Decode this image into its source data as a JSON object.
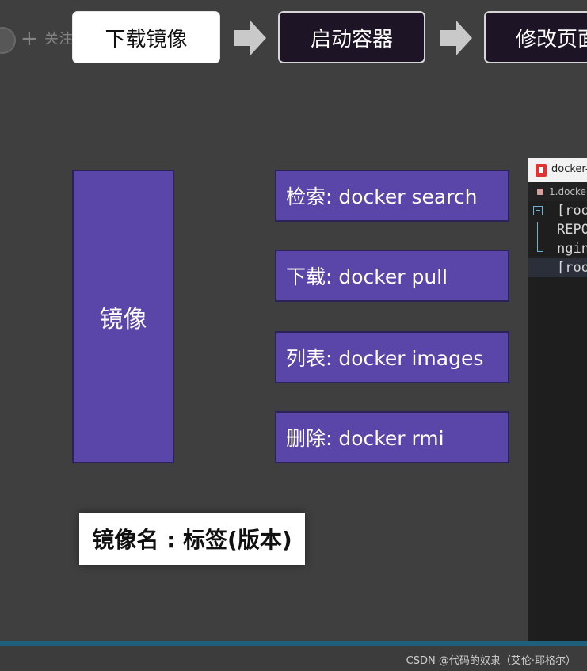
{
  "follow": {
    "label": "关注"
  },
  "steps": [
    {
      "label": "下载镜像"
    },
    {
      "label": "启动容器"
    },
    {
      "label": "修改页面"
    }
  ],
  "image_box": {
    "label": "镜像"
  },
  "commands": [
    {
      "label": "检索:  docker search"
    },
    {
      "label": "下载:  docker pull"
    },
    {
      "label": "列表:  docker images"
    },
    {
      "label": "删除:  docker rmi"
    }
  ],
  "tag_card": {
    "label": "镜像名 : 标签(版本)"
  },
  "terminal": {
    "title": "docker-l",
    "tab": "1.docke",
    "lines": [
      "[roo",
      "REPO",
      "ngin",
      "[roo"
    ]
  },
  "watermark": "CSDN @代码的奴隶（艾伦·耶格尔）",
  "colors": {
    "box_fill": "#5a46a8",
    "step_dark": "#1d1425",
    "background": "#3f3f3f"
  }
}
